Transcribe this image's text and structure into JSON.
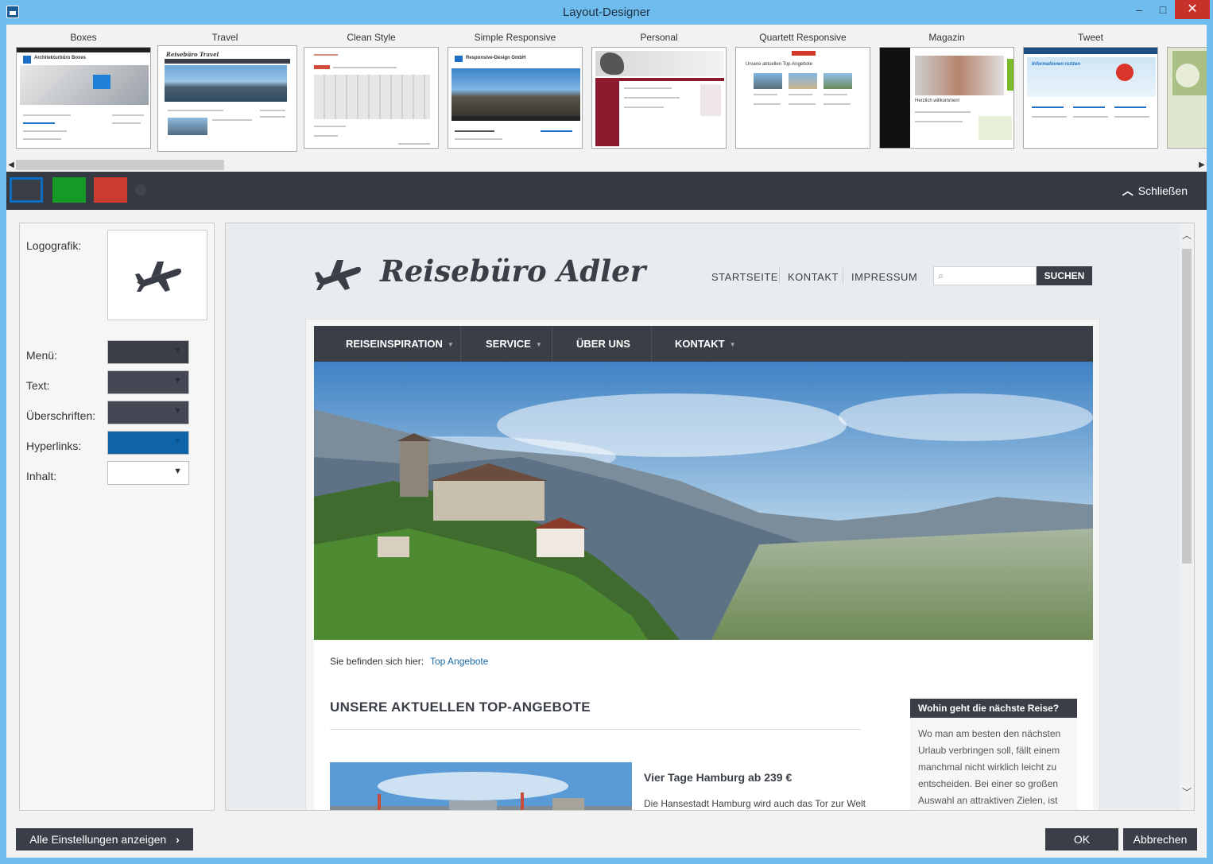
{
  "window": {
    "title": "Layout-Designer",
    "minimize": "–",
    "maximize": "□",
    "close": "✕"
  },
  "templates": [
    {
      "label": "Boxes",
      "selected": false,
      "inner_title": "Architekturbüro Boxes"
    },
    {
      "label": "Travel",
      "selected": true,
      "inner_title": "Reisebüro Travel"
    },
    {
      "label": "Clean Style",
      "selected": false
    },
    {
      "label": "Simple Responsive",
      "selected": false,
      "inner_title": "Responsive-Design GmbH"
    },
    {
      "label": "Personal",
      "selected": false
    },
    {
      "label": "Quartett Responsive",
      "selected": false,
      "inner_title": "Unsere aktuellen Top-Angebote"
    },
    {
      "label": "Magazin",
      "selected": false,
      "inner_title": "Herzlich willkommen!"
    },
    {
      "label": "Tweet",
      "selected": false,
      "inner_title": "Informationen nutzen"
    },
    {
      "label": "",
      "selected": false
    }
  ],
  "scheme": {
    "swatches": [
      {
        "name": "dark",
        "color": "#3a3f47",
        "selected": true
      },
      {
        "name": "green",
        "color": "#169a27",
        "selected": false
      },
      {
        "name": "red",
        "color": "#cc3b2f",
        "selected": false
      }
    ],
    "close_label": "Schließen"
  },
  "settings": {
    "logo_label": "Logografik:",
    "menu_label": "Menü:",
    "text_label": "Text:",
    "headings_label": "Überschriften:",
    "links_label": "Hyperlinks:",
    "content_label": "Inhalt:",
    "colors": {
      "menu": "#3a3f47",
      "text": "#434854",
      "headings": "#434854",
      "links": "#0f64a8",
      "content": "#ffffff"
    }
  },
  "preview": {
    "site_title": "Reisebüro Adler",
    "top_nav": [
      "STARTSEITE",
      "KONTAKT",
      "IMPRESSUM"
    ],
    "search_button": "SUCHEN",
    "main_nav": [
      {
        "label": "REISEINSPIRATION",
        "has_dropdown": true
      },
      {
        "label": "SERVICE",
        "has_dropdown": true
      },
      {
        "label": "ÜBER UNS",
        "has_dropdown": false
      },
      {
        "label": "KONTAKT",
        "has_dropdown": true
      }
    ],
    "breadcrumb_label": "Sie befinden sich hier:",
    "breadcrumb_link": "Top Angebote",
    "offers_heading": "UNSERE AKTUELLEN TOP-ANGEBOTE",
    "offer_title": "Vier Tage Hamburg ab 239 €",
    "offer_text": "Die Hansestadt Hamburg wird auch das Tor zur Welt",
    "sidebar_heading": "Wohin geht die nächste Reise?",
    "sidebar_text": "Wo man am besten den nächsten Urlaub verbringen soll, fällt einem manchmal nicht wirklich leicht zu entscheiden. Bei einer so großen Auswahl an attraktiven Zielen, ist"
  },
  "footer": {
    "all_settings": "Alle Einstellungen anzeigen",
    "ok": "OK",
    "cancel": "Abbrechen"
  }
}
